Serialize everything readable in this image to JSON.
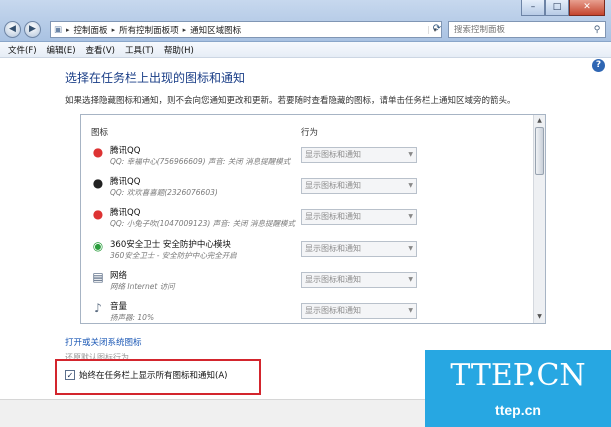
{
  "window": {
    "minimize": "–",
    "maximize": "□",
    "close": "✕"
  },
  "nav": {
    "back": "◀",
    "forward": "▶"
  },
  "address": {
    "segments": [
      "控制面板",
      "所有控制面板项",
      "通知区域图标"
    ],
    "separator": "▸",
    "dropdown": "▾",
    "refresh": "⟳"
  },
  "search": {
    "placeholder": "搜索控制面板"
  },
  "menu": [
    "文件(F)",
    "编辑(E)",
    "查看(V)",
    "工具(T)",
    "帮助(H)"
  ],
  "page": {
    "help": "?",
    "title": "选择在任务栏上出现的图标和通知",
    "description": "如果选择隐藏图标和通知，则不会向您通知更改和更新。若要随时查看隐藏的图标，请单击任务栏上通知区域旁的箭头。"
  },
  "table": {
    "columns": [
      "图标",
      "行为"
    ],
    "rows": [
      {
        "icon": "qq-penguin-icon",
        "name": "腾讯QQ",
        "sub": "QQ: 幸福中心(756966609) 声音: 关闭 消息提醒模式",
        "behavior": "显示图标和通知"
      },
      {
        "icon": "qq-penguin-icon",
        "name": "腾讯QQ",
        "sub": "QQ: 欢欢喜喜题(2326076603)",
        "behavior": "显示图标和通知"
      },
      {
        "icon": "qq-penguin-icon",
        "name": "腾讯QQ",
        "sub": "QQ: 小兔子吹(1047009123) 声音: 关闭 消息提醒模式",
        "behavior": "显示图标和通知"
      },
      {
        "icon": "360-shield-icon",
        "name": "360安全卫士 安全防护中心模块",
        "sub": "360安全卫士 - 安全防护中心完全开启",
        "behavior": "显示图标和通知"
      },
      {
        "icon": "network-icon",
        "name": "网络",
        "sub": "网络 Internet 访问",
        "behavior": "显示图标和通知"
      },
      {
        "icon": "volume-icon",
        "name": "音量",
        "sub": "扬声器: 10%",
        "behavior": "显示图标和通知"
      }
    ]
  },
  "links": {
    "toggle_system_icons": "打开或关闭系统图标",
    "restore_defaults": "还原默认图标行为"
  },
  "checkbox": {
    "label": "始终在任务栏上显示所有图标和通知(A)",
    "checked": true,
    "mark": "✓"
  },
  "watermark": {
    "main": "TTEP.CN",
    "sub": "ttep.cn"
  },
  "colors": {
    "accent": "#1a3e87",
    "link": "#1a57b5",
    "highlight": "#d3252d",
    "watermark": "#27a7e2"
  }
}
